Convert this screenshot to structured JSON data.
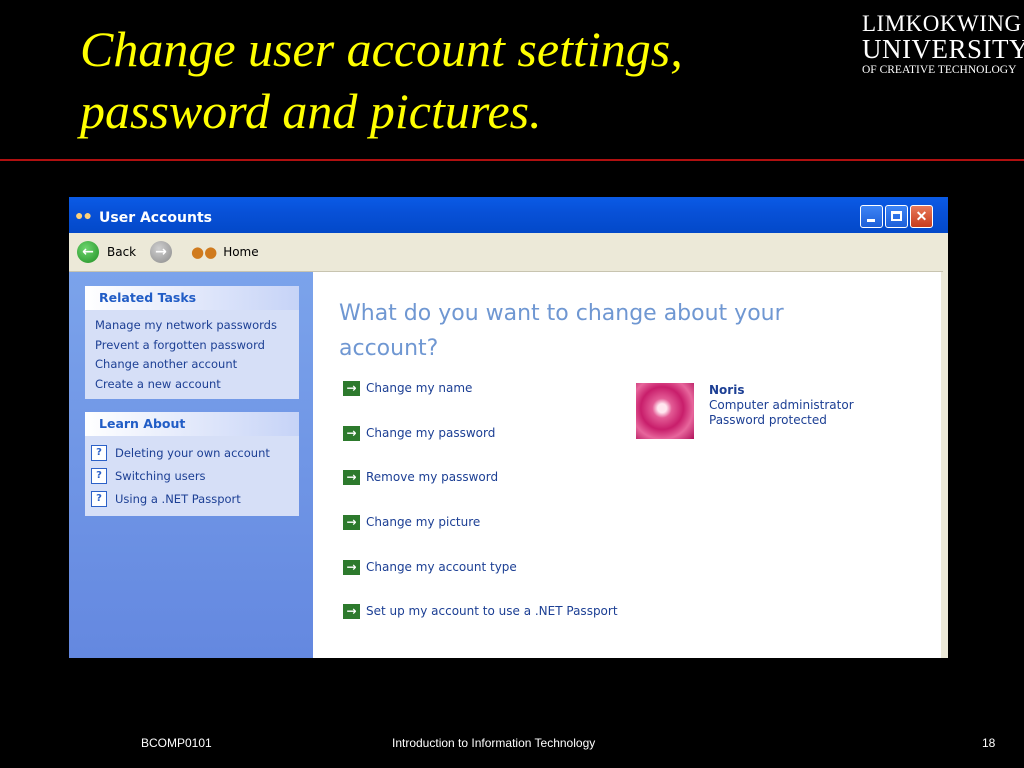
{
  "slide": {
    "title_line1": "Change user account settings,",
    "title_line2": "password and pictures.",
    "logo": {
      "line1": "LIMKOKWING",
      "line2": "UNIVERSITY",
      "line3": "OF CREATIVE TECHNOLOGY"
    },
    "footer": {
      "left": "BCOMP0101",
      "center": "Introduction to Information Technology",
      "page": "18"
    }
  },
  "window": {
    "title": "User Accounts",
    "toolbar": {
      "back_label": "Back",
      "home_label": "Home"
    },
    "related_tasks": {
      "heading": "Related Tasks",
      "items": [
        "Manage my network passwords",
        "Prevent a forgotten password",
        "Change another account",
        "Create a new account"
      ]
    },
    "learn_about": {
      "heading": "Learn About",
      "items": [
        "Deleting your own account",
        "Switching users",
        "Using a .NET Passport"
      ]
    },
    "main": {
      "heading": "What do you want to change about your account?",
      "tasks": [
        "Change my name",
        "Change my password",
        "Remove my password",
        "Change my picture",
        "Change my account type",
        "Set up my account to use a .NET Passport"
      ]
    },
    "user": {
      "name": "Noris",
      "role": "Computer administrator",
      "status": "Password protected"
    }
  },
  "colors": {
    "title_yellow": "#ffff00",
    "divider_red": "#b01010",
    "xp_blue": "#0a5be6",
    "link_blue": "#1c3f94",
    "heading_blue": "#6f97d2"
  },
  "icons": [
    "back-arrow-icon",
    "forward-arrow-icon",
    "home-people-icon",
    "help-question-icon",
    "green-arrow-icon",
    "minimize-icon",
    "maximize-icon",
    "close-icon"
  ]
}
